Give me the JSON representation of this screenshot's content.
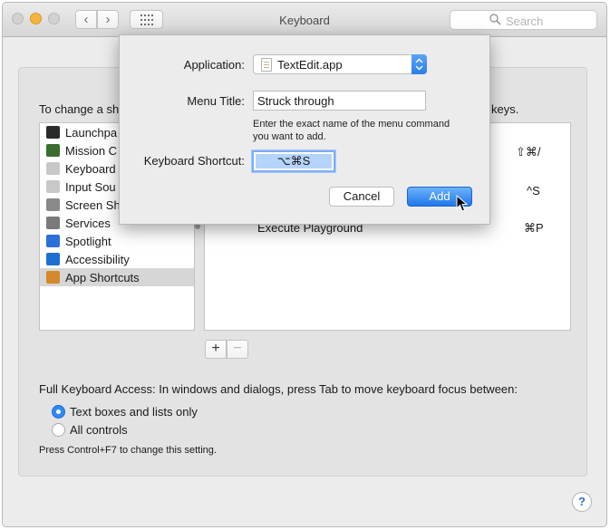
{
  "window": {
    "title": "Keyboard",
    "search_placeholder": "Search"
  },
  "toolbar": {
    "back_glyph": "‹",
    "forward_glyph": "›",
    "show_all_icon": "grid-icon"
  },
  "instructions": {
    "prefix": "To change a sh",
    "suffix": "keys."
  },
  "categories": [
    {
      "label": "Launchpa",
      "icon": "launchpad-icon",
      "color": "#2a2a2a"
    },
    {
      "label": "Mission C",
      "icon": "mission-control-icon",
      "color": "#3a6d2e"
    },
    {
      "label": "Keyboard",
      "icon": "keyboard-icon",
      "color": "#c8c8c8"
    },
    {
      "label": "Input Sou",
      "icon": "input-sources-icon",
      "color": "#c8c8c8"
    },
    {
      "label": "Screen Sh",
      "icon": "screenshot-icon",
      "color": "#8a8a8a"
    },
    {
      "label": "Services",
      "icon": "gear-icon",
      "color": "#7a7a7a"
    },
    {
      "label": "Spotlight",
      "icon": "spotlight-icon",
      "color": "#2a70d6"
    },
    {
      "label": "Accessibility",
      "icon": "accessibility-icon",
      "color": "#1f6fd1"
    },
    {
      "label": "App Shortcuts",
      "icon": "app-shortcuts-icon",
      "color": "#d48a2a",
      "selected": true
    }
  ],
  "shortcuts": [
    {
      "name": "",
      "key": "⇧⌘/"
    },
    {
      "name": "",
      "key": "^S"
    },
    {
      "name": "Execute Playground",
      "key": "⌘P"
    }
  ],
  "buttons": {
    "plus": "+",
    "minus": "−"
  },
  "full_keyboard_access": {
    "label": "Full Keyboard Access: In windows and dialogs, press Tab to move keyboard focus between:",
    "options": [
      {
        "label": "Text boxes and lists only",
        "selected": true
      },
      {
        "label": "All controls",
        "selected": false
      }
    ],
    "note": "Press Control+F7 to change this setting."
  },
  "help_glyph": "?",
  "sheet": {
    "application_label": "Application:",
    "application_value": "TextEdit.app",
    "menu_title_label": "Menu Title:",
    "menu_title_value": "Struck through",
    "hint_line1": "Enter the exact name of the menu command",
    "hint_line2": "you want to add.",
    "shortcut_label": "Keyboard Shortcut:",
    "shortcut_value": "⌥⌘S",
    "cancel_label": "Cancel",
    "add_label": "Add"
  }
}
